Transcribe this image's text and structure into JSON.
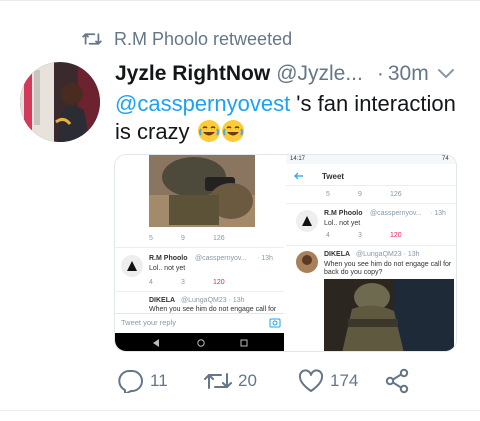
{
  "retweet": {
    "text": "R.M Phoolo retweeted",
    "icon": "retweet-icon"
  },
  "tweet": {
    "display_name": "Jyzle RightNow",
    "handle": "@Jyzle...",
    "separator": "·",
    "time": "30m",
    "mention": "@casspernyovest",
    "text_rest": " 's fan interaction is crazy",
    "emojis": [
      "joy-emoji",
      "joy-emoji"
    ]
  },
  "media": {
    "left": {
      "first_actions": {
        "replies": "5",
        "retweets": "9",
        "likes": "126"
      },
      "reply": {
        "name": "R.M Phoolo",
        "handle": "@casspernyov...",
        "time": "· 13h",
        "text": "Lol.. not yet"
      },
      "reply_actions": {
        "replies": "4",
        "retweets": "3",
        "likes": "120"
      },
      "next_name": "DIKELA",
      "next_handle": "@LungaQM23 · 13h",
      "next_text": "When you see him do not engage call for",
      "compose_placeholder": "Tweet your reply"
    },
    "right": {
      "status_time": "14:17",
      "battery": "74",
      "header_title": "Tweet",
      "first_actions": {
        "replies": "5",
        "retweets": "9",
        "likes": "126"
      },
      "reply": {
        "name": "R.M Phoolo",
        "handle": "@casspernyov...",
        "time": "· 13h",
        "text": "Lol.. not yet"
      },
      "reply_actions": {
        "replies": "4",
        "retweets": "3",
        "likes": "120"
      },
      "next_name": "DIKELA",
      "next_handle": "@LungaQM23 · 13h",
      "next_text_1": "When you see him do not engage call for",
      "next_text_2": "back do you copy?"
    }
  },
  "actions": {
    "replies": "11",
    "retweets": "20",
    "likes": "174"
  },
  "colors": {
    "link": "#1da1f2",
    "muted": "#657786",
    "like": "#e0245e"
  }
}
